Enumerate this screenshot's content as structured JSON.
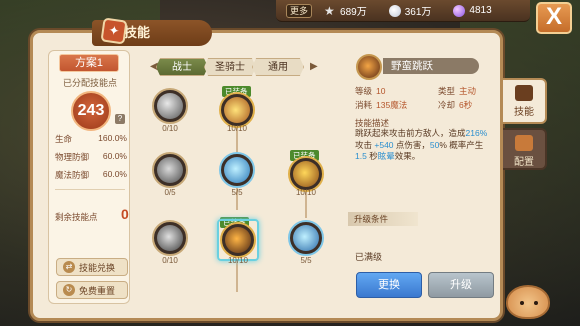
{
  "topbar": {
    "more_label": "更多",
    "star_value": "689万",
    "shell_value": "361万",
    "orb_value": "4813",
    "close_label": "X"
  },
  "title": "技能",
  "left_panel": {
    "plan_label": "方案1",
    "allocated_label": "已分配技能点",
    "allocated_value": "243",
    "stats": [
      {
        "label": "生命",
        "value": "160.0%"
      },
      {
        "label": "物理防御",
        "value": "60.0%"
      },
      {
        "label": "魔法防御",
        "value": "60.0%"
      }
    ],
    "remaining_label": "剩余技能点",
    "remaining_value": "0",
    "exchange_label": "技能兑换",
    "reset_label": "免费重置"
  },
  "tabs": [
    {
      "label": "战士",
      "active": true
    },
    {
      "label": "圣骑士",
      "active": false
    },
    {
      "label": "通用",
      "active": false
    }
  ],
  "tree": {
    "equipped_label": "已装备",
    "nodes": [
      {
        "id": "n1",
        "level": "0/10",
        "equipped": false
      },
      {
        "id": "n2",
        "level": "10/10",
        "equipped": true
      },
      {
        "id": "n3",
        "level": "0/5",
        "equipped": false
      },
      {
        "id": "n4",
        "level": "5/5",
        "equipped": false
      },
      {
        "id": "n5",
        "level": "10/10",
        "equipped": true
      },
      {
        "id": "n6",
        "level": "0/10",
        "equipped": false
      },
      {
        "id": "n7",
        "level": "10/10",
        "equipped": true
      },
      {
        "id": "n8",
        "level": "5/5",
        "equipped": false
      }
    ]
  },
  "skill": {
    "name": "野蛮跳跃",
    "level_label": "等级",
    "level_value": "10",
    "type_label": "类型",
    "type_value": "主动",
    "cost_label": "消耗",
    "cost_value": "135魔法",
    "cooldown_label": "冷却",
    "cooldown_value": "6秒",
    "desc_title": "技能描述",
    "desc_part1": "跳跃起来攻击前方敌人，造成",
    "desc_hl1": "216%",
    "desc_part2": " 攻击 ",
    "desc_hl2": "+540",
    "desc_part3": " 点伤害，",
    "desc_hl3": "50",
    "desc_part4": "% 概率产生 ",
    "desc_hl4": "1.5",
    "desc_part5": " 秒",
    "desc_hl5": "眩晕",
    "desc_part6": "效果。",
    "upgrade_cond_label": "升级条件",
    "maxed_label": "已满级",
    "replace_label": "更换",
    "upgrade_label": "升级"
  },
  "side_tabs": [
    {
      "label": "技能",
      "active": true
    },
    {
      "label": "配置",
      "active": false
    }
  ],
  "colors": {
    "accent": "#c25630",
    "button_blue": "#3a78cf",
    "equipped_green": "#4c8a2c",
    "highlight_text": "#2b8fcf"
  }
}
